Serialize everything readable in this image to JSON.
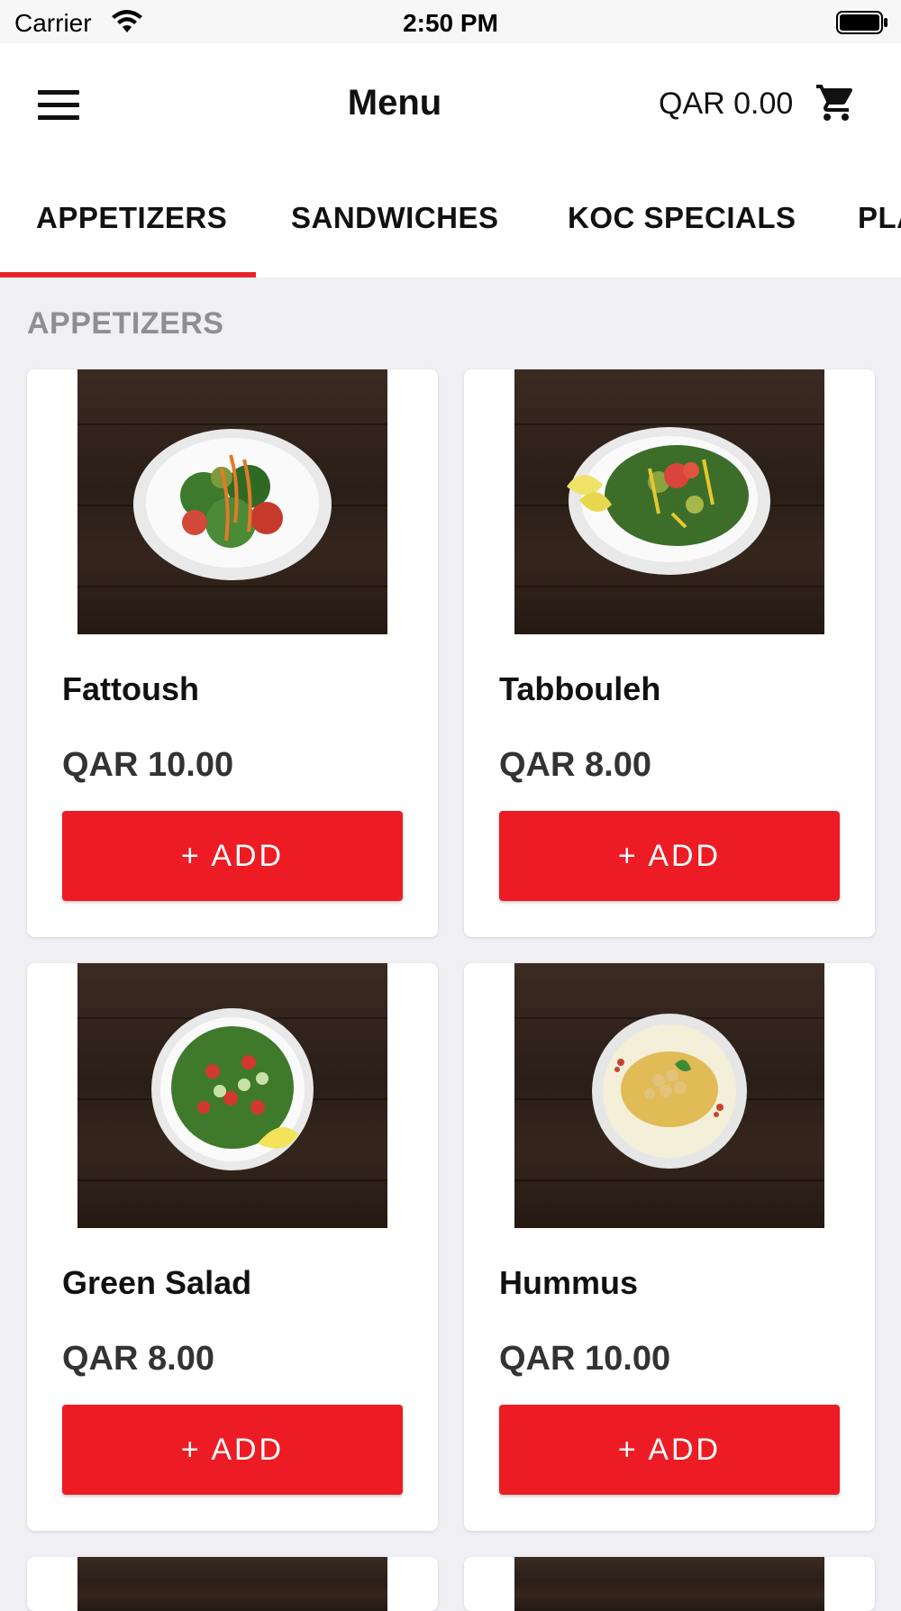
{
  "status_bar": {
    "carrier": "Carrier",
    "time": "2:50 PM"
  },
  "header": {
    "title": "Menu",
    "cart_total": "QAR 0.00"
  },
  "tabs": [
    {
      "label": "APPETIZERS",
      "active": true
    },
    {
      "label": "SANDWICHES",
      "active": false
    },
    {
      "label": "KOC SPECIALS",
      "active": false
    },
    {
      "label": "PLA",
      "active": false
    }
  ],
  "section": {
    "title": "APPETIZERS"
  },
  "items": [
    {
      "name": "Fattoush",
      "price": "QAR 10.00",
      "button": "+ ADD"
    },
    {
      "name": "Tabbouleh",
      "price": "QAR 8.00",
      "button": "+ ADD"
    },
    {
      "name": "Green Salad",
      "price": "QAR 8.00",
      "button": "+ ADD"
    },
    {
      "name": "Hummus",
      "price": "QAR 10.00",
      "button": "+ ADD"
    }
  ],
  "colors": {
    "accent": "#ed1c24",
    "background": "#efeff4",
    "section_title": "#8e8e93"
  }
}
